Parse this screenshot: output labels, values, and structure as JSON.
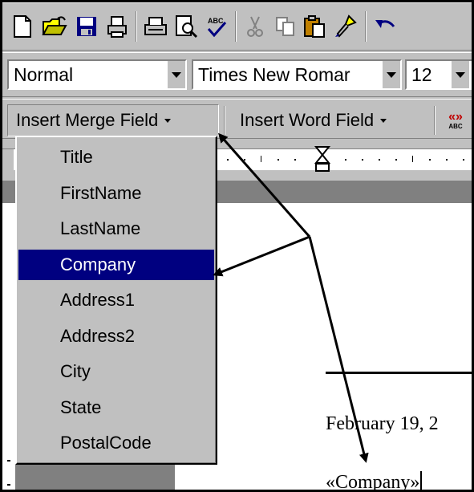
{
  "toolbar_standard": {
    "icons": [
      "new-document-icon",
      "open-folder-icon",
      "save-icon",
      "print-preview-page-icon",
      "print-icon",
      "print-preview-icon",
      "spelling-check-icon",
      "cut-icon",
      "copy-icon",
      "paste-icon",
      "format-painter-icon",
      "undo-icon"
    ]
  },
  "toolbar_formatting": {
    "style_value": "Normal",
    "font_value": "Times New Romar",
    "size_value": "12"
  },
  "toolbar_mailmerge": {
    "insert_merge_field_label": "Insert Merge Field",
    "insert_word_field_label": "Insert Word Field",
    "view_merged_data_icon_text": "«»",
    "view_merged_data_icon_sub": "ABC"
  },
  "merge_field_menu": {
    "items": [
      "Title",
      "FirstName",
      "LastName",
      "Company",
      "Address1",
      "Address2",
      "City",
      "State",
      "PostalCode"
    ],
    "selected": "Company"
  },
  "document": {
    "date_text": "February 19, 2",
    "merge_field_text": "«Company»"
  },
  "colors": {
    "face": "#c0c0c0",
    "highlight": "#000080",
    "workspace": "#808080"
  }
}
